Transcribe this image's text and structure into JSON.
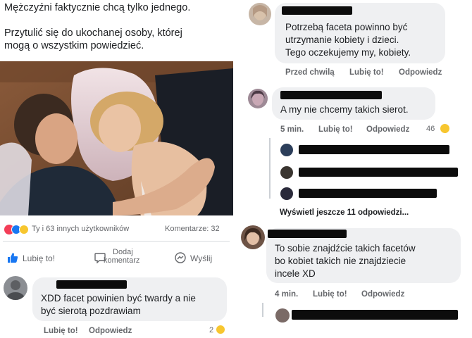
{
  "post": {
    "line1": "Mężczyźni faktycznie chcą tylko jednego.",
    "line2": "Przytulić się do ukochanej osoby, której",
    "line3": "mogą o wszystkim powiedzieć.",
    "reactions_text": "Ty i 63 innych użytkowników",
    "comments_count": "Komentarze: 32",
    "actions": {
      "like": "Lubię to!",
      "comment_l1": "Dodaj",
      "comment_l2": "komentarz",
      "share": "Wyślij"
    }
  },
  "left_comment": {
    "text_l1": "XDD facet powinien być twardy a nie",
    "text_l2": "być sierotą pozdrawiam",
    "like": "Lubię to!",
    "reply": "Odpowiedz",
    "reaction_count": "2"
  },
  "right": {
    "c1": {
      "l1": "Potrzebą faceta powinno być",
      "l2": "utrzymanie kobiety i dzieci.",
      "l3": "Tego oczekujemy my, kobiety.",
      "time": "Przed chwilą",
      "like": "Lubię to!",
      "reply": "Odpowiedz"
    },
    "c2": {
      "text": "A my nie chcemy takich sierot.",
      "time": "5 min.",
      "like": "Lubię to!",
      "reply": "Odpowiedz",
      "reaction_count": "46"
    },
    "more_replies": "Wyświetl jeszcze 11 odpowiedzi...",
    "c3": {
      "l1": "To sobie znajdźcie takich facetów",
      "l2": "bo kobiet takich nie znajdziecie",
      "l3": "incele XD",
      "time": "4 min.",
      "like": "Lubię to!",
      "reply": "Odpowiedz"
    }
  },
  "colors": {
    "like_blue": "#1877f2",
    "meta_gray": "#65676b",
    "bubble_bg": "#eff0f2"
  }
}
